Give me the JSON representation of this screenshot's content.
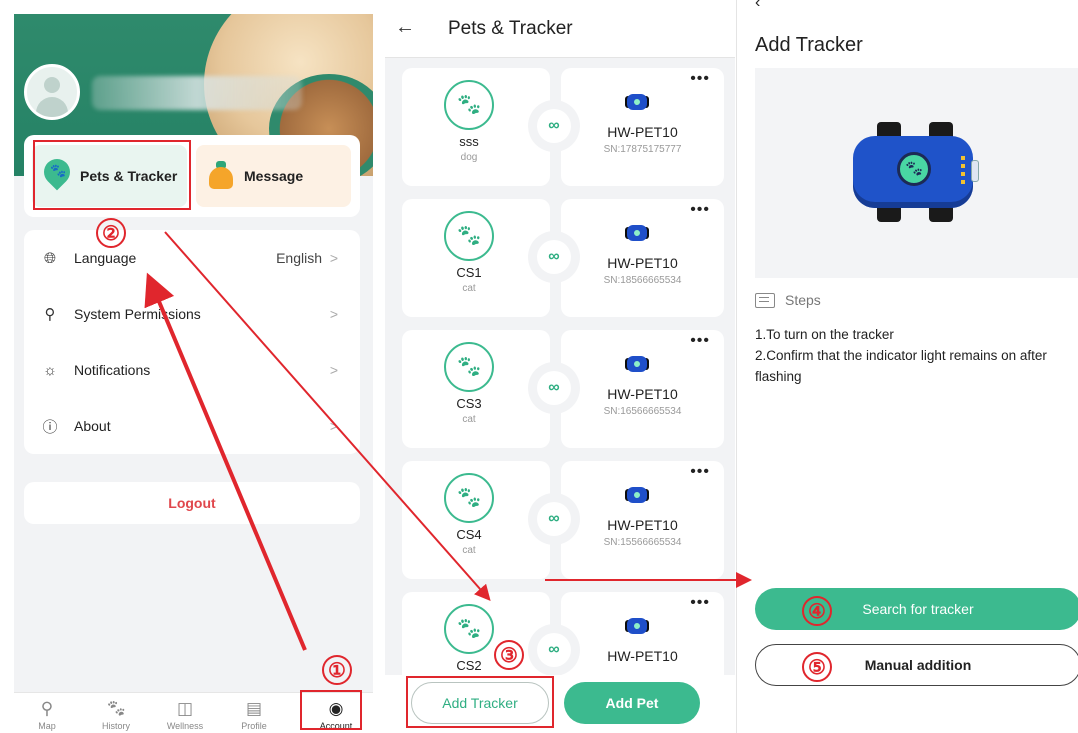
{
  "account": {
    "quick": [
      {
        "label": "Pets & Tracker",
        "icon": "paw-pin-icon"
      },
      {
        "label": "Message",
        "icon": "bell-icon"
      }
    ],
    "menu": [
      {
        "icon": "globe-icon",
        "label": "Language",
        "value": "English"
      },
      {
        "icon": "user-permissions-icon",
        "label": "System Permissions",
        "value": ""
      },
      {
        "icon": "alarm-bell-icon",
        "label": "Notifications",
        "value": ""
      },
      {
        "icon": "info-icon",
        "label": "About",
        "value": ""
      }
    ],
    "logout": "Logout",
    "tabs": [
      {
        "label": "Map",
        "icon": "location-icon"
      },
      {
        "label": "History",
        "icon": "paw-icon"
      },
      {
        "label": "Wellness",
        "icon": "folder-plus-icon"
      },
      {
        "label": "Profile",
        "icon": "card-icon"
      },
      {
        "label": "Account",
        "icon": "account-icon"
      }
    ]
  },
  "pets": {
    "title": "Pets & Tracker",
    "items": [
      {
        "name": "sss",
        "type": "dog",
        "device": "HW-PET10",
        "sn": "SN:17875175777"
      },
      {
        "name": "CS1",
        "type": "cat",
        "device": "HW-PET10",
        "sn": "SN:18566665534"
      },
      {
        "name": "CS3",
        "type": "cat",
        "device": "HW-PET10",
        "sn": "SN:16566665534"
      },
      {
        "name": "CS4",
        "type": "cat",
        "device": "HW-PET10",
        "sn": "SN:15566665534"
      },
      {
        "name": "CS2",
        "type": "",
        "device": "HW-PET10",
        "sn": ""
      }
    ],
    "add_tracker": "Add Tracker",
    "add_pet": "Add Pet"
  },
  "add_tracker": {
    "title": "Add Tracker",
    "steps_heading": "Steps",
    "steps": [
      "1.To turn on the tracker",
      "2.Confirm that the indicator light remains on after flashing"
    ],
    "search_button": "Search for tracker",
    "manual_button": "Manual addition"
  },
  "annotations": [
    "①",
    "②",
    "③",
    "④",
    "⑤"
  ],
  "colors": {
    "accent": "#3cba8f",
    "annotation": "#e0262d",
    "logout": "#e0474c"
  }
}
